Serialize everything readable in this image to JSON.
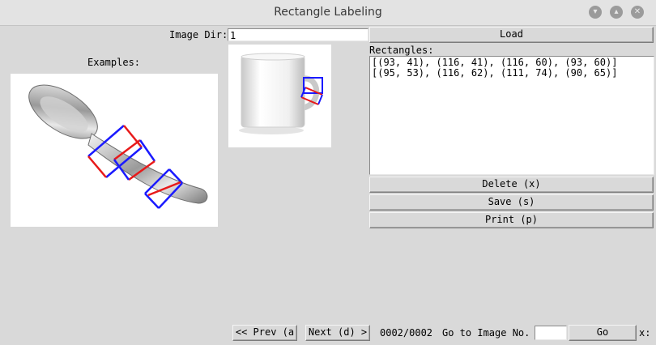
{
  "window": {
    "title": "Rectangle Labeling",
    "controls": [
      "minimize-icon",
      "maximize-icon",
      "close-icon"
    ]
  },
  "image_dir": {
    "label": "Image Dir:",
    "value": "1",
    "load_label": "Load"
  },
  "examples": {
    "label": "Examples:"
  },
  "rectangles": {
    "label": "Rectangles:",
    "items": [
      "[(93, 41), (116, 41), (116, 60), (93, 60)]",
      "[(95, 53), (116, 62), (111, 74), (90, 65)]"
    ]
  },
  "actions": {
    "delete_label": "Delete (x)",
    "save_label": "Save (s)",
    "print_label": "Print (p)"
  },
  "nav": {
    "prev_label": "<< Prev (a",
    "next_label": "Next (d) >",
    "counter": "0002/0002",
    "goto_label": "Go to Image No.",
    "goto_value": "",
    "go_label": "Go",
    "trailing_label": "x:"
  },
  "colors": {
    "box_edge_primary": "#1a1aff",
    "box_edge_secondary": "#e81a1a",
    "background": "#d9d9d9"
  }
}
